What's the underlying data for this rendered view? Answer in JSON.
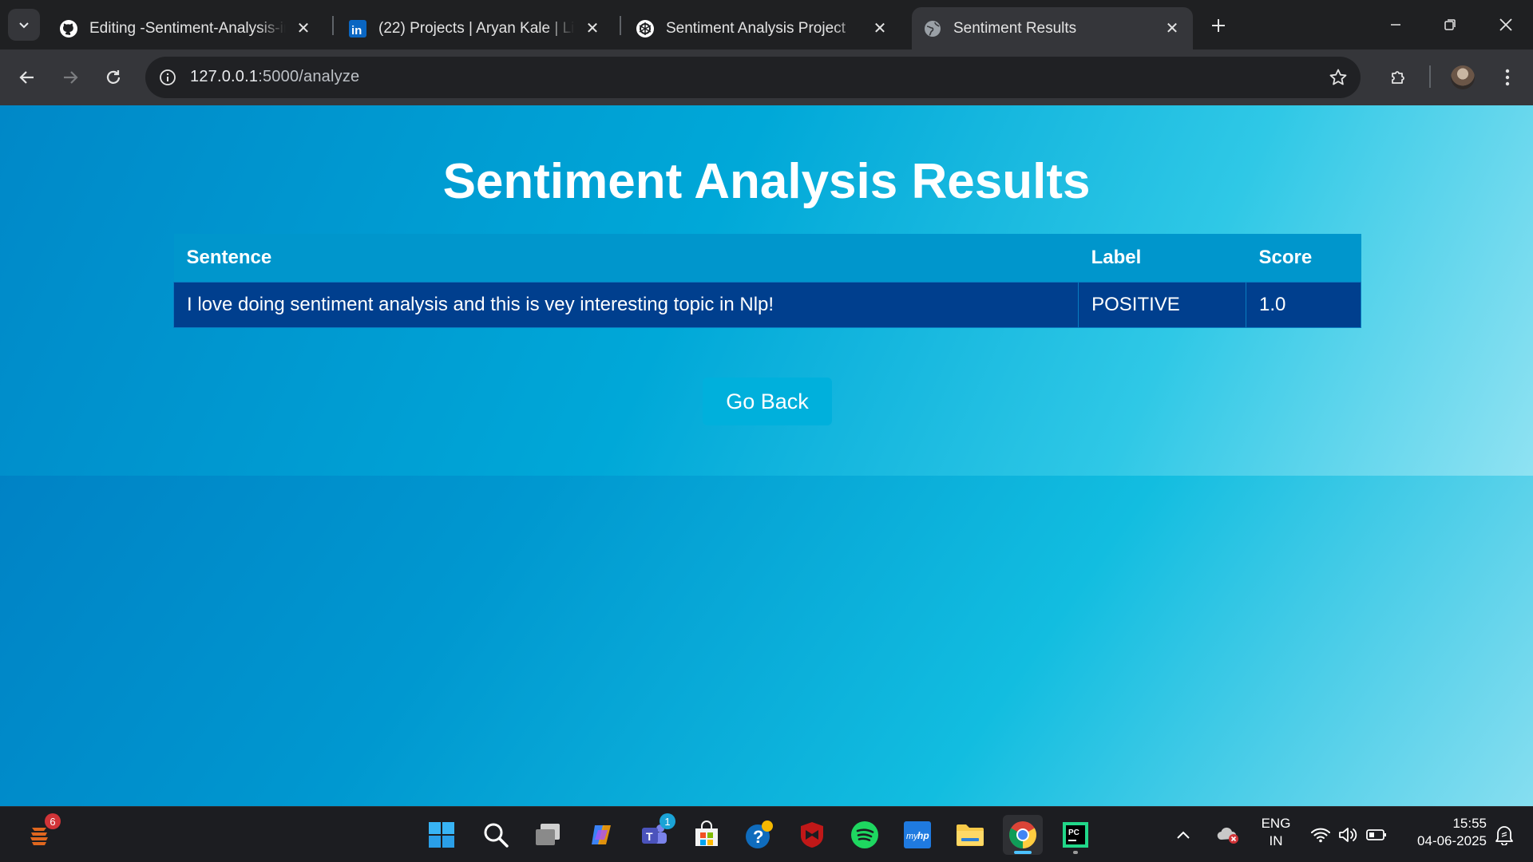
{
  "browser": {
    "tabs": [
      {
        "title": "Editing -Sentiment-Analysis-in-NLP",
        "icon": "github-icon",
        "active": false
      },
      {
        "title": "(22) Projects | Aryan Kale | LinkedIn",
        "icon": "linkedin-icon",
        "active": false
      },
      {
        "title": "Sentiment Analysis Project",
        "icon": "chatgpt-icon",
        "active": false
      },
      {
        "title": "Sentiment Results",
        "icon": "globe-icon",
        "active": true
      }
    ],
    "address": {
      "url_host": "127.0.0.1",
      "url_rest": ":5000/analyze"
    }
  },
  "page": {
    "title": "Sentiment Analysis Results",
    "table": {
      "headers": [
        "Sentence",
        "Label",
        "Score"
      ],
      "rows": [
        {
          "sentence": "I love doing sentiment analysis and this is vey interesting topic in Nlp!",
          "label": "POSITIVE",
          "score": "1.0"
        }
      ]
    },
    "go_back_label": "Go Back"
  },
  "taskbar": {
    "left_widget_badge": "6",
    "teams_badge": "1",
    "language": {
      "line1": "ENG",
      "line2": "IN"
    },
    "clock": {
      "time": "15:55",
      "date": "04-06-2025"
    }
  },
  "colors": {
    "header_cell": "#0096cc",
    "row_cell": "#003f8e",
    "button": "#00b0dc"
  }
}
